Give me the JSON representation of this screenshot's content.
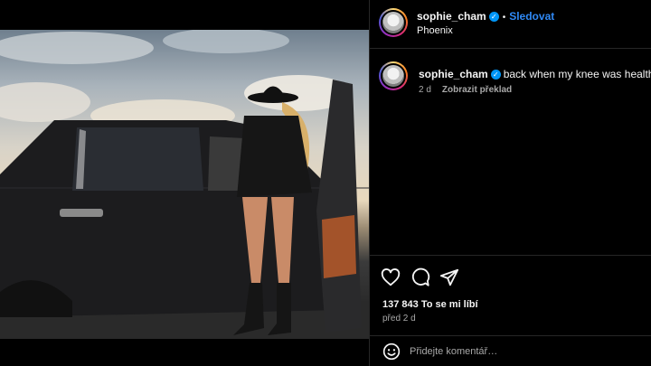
{
  "post": {
    "username": "sophie_cham",
    "verified": true,
    "follow_label": "Sledovat",
    "separator": "•",
    "location": "Phoenix"
  },
  "caption": {
    "username": "sophie_cham",
    "text": "back when my knee was healthy",
    "age": "2 d",
    "translate_label": "Zobrazit překlad"
  },
  "actions": {
    "icons": [
      "heart-icon",
      "comment-icon",
      "share-icon"
    ]
  },
  "stats": {
    "likes": "137 843 To se mi líbí",
    "posted": "před 2 d"
  },
  "comment": {
    "placeholder": "Přidejte komentář…",
    "icon": "emoji-icon"
  },
  "colors": {
    "background": "#000000",
    "accent": "#2f89f5",
    "verified": "#0095f6",
    "muted": "#a8a8a8",
    "border": "#262626"
  }
}
